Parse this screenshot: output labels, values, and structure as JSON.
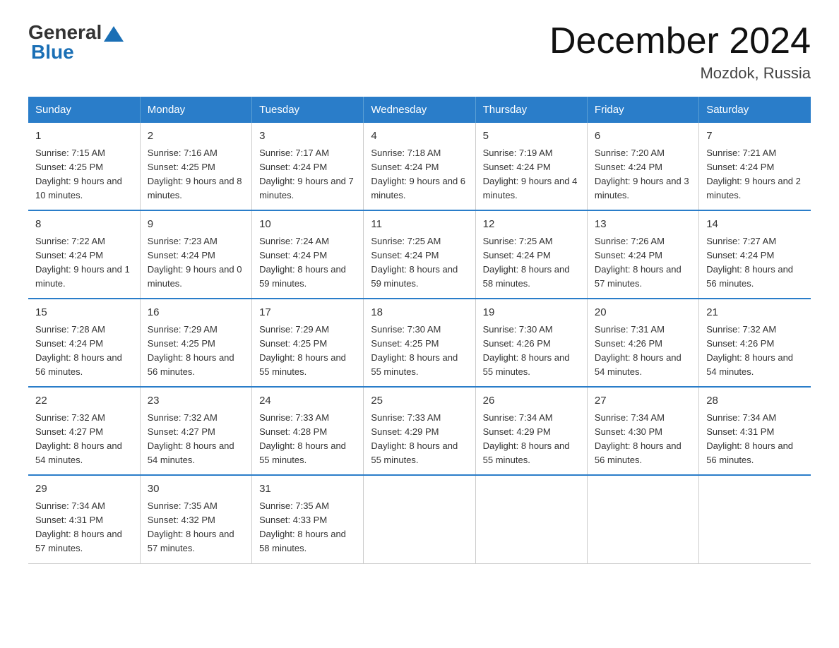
{
  "header": {
    "logo_general": "General",
    "logo_blue": "Blue",
    "title": "December 2024",
    "location": "Mozdok, Russia"
  },
  "days_of_week": [
    "Sunday",
    "Monday",
    "Tuesday",
    "Wednesday",
    "Thursday",
    "Friday",
    "Saturday"
  ],
  "weeks": [
    [
      {
        "day": "1",
        "sunrise": "Sunrise: 7:15 AM",
        "sunset": "Sunset: 4:25 PM",
        "daylight": "Daylight: 9 hours and 10 minutes."
      },
      {
        "day": "2",
        "sunrise": "Sunrise: 7:16 AM",
        "sunset": "Sunset: 4:25 PM",
        "daylight": "Daylight: 9 hours and 8 minutes."
      },
      {
        "day": "3",
        "sunrise": "Sunrise: 7:17 AM",
        "sunset": "Sunset: 4:24 PM",
        "daylight": "Daylight: 9 hours and 7 minutes."
      },
      {
        "day": "4",
        "sunrise": "Sunrise: 7:18 AM",
        "sunset": "Sunset: 4:24 PM",
        "daylight": "Daylight: 9 hours and 6 minutes."
      },
      {
        "day": "5",
        "sunrise": "Sunrise: 7:19 AM",
        "sunset": "Sunset: 4:24 PM",
        "daylight": "Daylight: 9 hours and 4 minutes."
      },
      {
        "day": "6",
        "sunrise": "Sunrise: 7:20 AM",
        "sunset": "Sunset: 4:24 PM",
        "daylight": "Daylight: 9 hours and 3 minutes."
      },
      {
        "day": "7",
        "sunrise": "Sunrise: 7:21 AM",
        "sunset": "Sunset: 4:24 PM",
        "daylight": "Daylight: 9 hours and 2 minutes."
      }
    ],
    [
      {
        "day": "8",
        "sunrise": "Sunrise: 7:22 AM",
        "sunset": "Sunset: 4:24 PM",
        "daylight": "Daylight: 9 hours and 1 minute."
      },
      {
        "day": "9",
        "sunrise": "Sunrise: 7:23 AM",
        "sunset": "Sunset: 4:24 PM",
        "daylight": "Daylight: 9 hours and 0 minutes."
      },
      {
        "day": "10",
        "sunrise": "Sunrise: 7:24 AM",
        "sunset": "Sunset: 4:24 PM",
        "daylight": "Daylight: 8 hours and 59 minutes."
      },
      {
        "day": "11",
        "sunrise": "Sunrise: 7:25 AM",
        "sunset": "Sunset: 4:24 PM",
        "daylight": "Daylight: 8 hours and 59 minutes."
      },
      {
        "day": "12",
        "sunrise": "Sunrise: 7:25 AM",
        "sunset": "Sunset: 4:24 PM",
        "daylight": "Daylight: 8 hours and 58 minutes."
      },
      {
        "day": "13",
        "sunrise": "Sunrise: 7:26 AM",
        "sunset": "Sunset: 4:24 PM",
        "daylight": "Daylight: 8 hours and 57 minutes."
      },
      {
        "day": "14",
        "sunrise": "Sunrise: 7:27 AM",
        "sunset": "Sunset: 4:24 PM",
        "daylight": "Daylight: 8 hours and 56 minutes."
      }
    ],
    [
      {
        "day": "15",
        "sunrise": "Sunrise: 7:28 AM",
        "sunset": "Sunset: 4:24 PM",
        "daylight": "Daylight: 8 hours and 56 minutes."
      },
      {
        "day": "16",
        "sunrise": "Sunrise: 7:29 AM",
        "sunset": "Sunset: 4:25 PM",
        "daylight": "Daylight: 8 hours and 56 minutes."
      },
      {
        "day": "17",
        "sunrise": "Sunrise: 7:29 AM",
        "sunset": "Sunset: 4:25 PM",
        "daylight": "Daylight: 8 hours and 55 minutes."
      },
      {
        "day": "18",
        "sunrise": "Sunrise: 7:30 AM",
        "sunset": "Sunset: 4:25 PM",
        "daylight": "Daylight: 8 hours and 55 minutes."
      },
      {
        "day": "19",
        "sunrise": "Sunrise: 7:30 AM",
        "sunset": "Sunset: 4:26 PM",
        "daylight": "Daylight: 8 hours and 55 minutes."
      },
      {
        "day": "20",
        "sunrise": "Sunrise: 7:31 AM",
        "sunset": "Sunset: 4:26 PM",
        "daylight": "Daylight: 8 hours and 54 minutes."
      },
      {
        "day": "21",
        "sunrise": "Sunrise: 7:32 AM",
        "sunset": "Sunset: 4:26 PM",
        "daylight": "Daylight: 8 hours and 54 minutes."
      }
    ],
    [
      {
        "day": "22",
        "sunrise": "Sunrise: 7:32 AM",
        "sunset": "Sunset: 4:27 PM",
        "daylight": "Daylight: 8 hours and 54 minutes."
      },
      {
        "day": "23",
        "sunrise": "Sunrise: 7:32 AM",
        "sunset": "Sunset: 4:27 PM",
        "daylight": "Daylight: 8 hours and 54 minutes."
      },
      {
        "day": "24",
        "sunrise": "Sunrise: 7:33 AM",
        "sunset": "Sunset: 4:28 PM",
        "daylight": "Daylight: 8 hours and 55 minutes."
      },
      {
        "day": "25",
        "sunrise": "Sunrise: 7:33 AM",
        "sunset": "Sunset: 4:29 PM",
        "daylight": "Daylight: 8 hours and 55 minutes."
      },
      {
        "day": "26",
        "sunrise": "Sunrise: 7:34 AM",
        "sunset": "Sunset: 4:29 PM",
        "daylight": "Daylight: 8 hours and 55 minutes."
      },
      {
        "day": "27",
        "sunrise": "Sunrise: 7:34 AM",
        "sunset": "Sunset: 4:30 PM",
        "daylight": "Daylight: 8 hours and 56 minutes."
      },
      {
        "day": "28",
        "sunrise": "Sunrise: 7:34 AM",
        "sunset": "Sunset: 4:31 PM",
        "daylight": "Daylight: 8 hours and 56 minutes."
      }
    ],
    [
      {
        "day": "29",
        "sunrise": "Sunrise: 7:34 AM",
        "sunset": "Sunset: 4:31 PM",
        "daylight": "Daylight: 8 hours and 57 minutes."
      },
      {
        "day": "30",
        "sunrise": "Sunrise: 7:35 AM",
        "sunset": "Sunset: 4:32 PM",
        "daylight": "Daylight: 8 hours and 57 minutes."
      },
      {
        "day": "31",
        "sunrise": "Sunrise: 7:35 AM",
        "sunset": "Sunset: 4:33 PM",
        "daylight": "Daylight: 8 hours and 58 minutes."
      },
      {
        "day": "",
        "sunrise": "",
        "sunset": "",
        "daylight": ""
      },
      {
        "day": "",
        "sunrise": "",
        "sunset": "",
        "daylight": ""
      },
      {
        "day": "",
        "sunrise": "",
        "sunset": "",
        "daylight": ""
      },
      {
        "day": "",
        "sunrise": "",
        "sunset": "",
        "daylight": ""
      }
    ]
  ]
}
